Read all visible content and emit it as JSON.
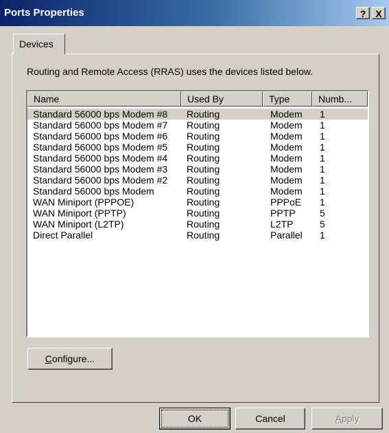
{
  "window": {
    "title": "Ports Properties",
    "help_label": "?",
    "close_label": "X"
  },
  "tabs": [
    {
      "label": "Devices"
    }
  ],
  "description": "Routing and Remote Access (RRAS) uses the devices listed below.",
  "list": {
    "columns": [
      "Name",
      "Used By",
      "Type",
      "Numb..."
    ],
    "rows": [
      [
        "Standard 56000 bps Modem #8",
        "Routing",
        "Modem",
        "1"
      ],
      [
        "Standard 56000 bps Modem #7",
        "Routing",
        "Modem",
        "1"
      ],
      [
        "Standard 56000 bps Modem #6",
        "Routing",
        "Modem",
        "1"
      ],
      [
        "Standard 56000 bps Modem #5",
        "Routing",
        "Modem",
        "1"
      ],
      [
        "Standard 56000 bps Modem #4",
        "Routing",
        "Modem",
        "1"
      ],
      [
        "Standard 56000 bps Modem #3",
        "Routing",
        "Modem",
        "1"
      ],
      [
        "Standard 56000 bps Modem #2",
        "Routing",
        "Modem",
        "1"
      ],
      [
        "Standard 56000 bps Modem",
        "Routing",
        "Modem",
        "1"
      ],
      [
        "WAN Miniport (PPPOE)",
        "Routing",
        "PPPoE",
        "1"
      ],
      [
        "WAN Miniport (PPTP)",
        "Routing",
        "PPTP",
        "5"
      ],
      [
        "WAN Miniport (L2TP)",
        "Routing",
        "L2TP",
        "5"
      ],
      [
        "Direct Parallel",
        "Routing",
        "Parallel",
        "1"
      ]
    ]
  },
  "buttons": {
    "configure_first": "C",
    "configure_rest": "onfigure...",
    "ok": "OK",
    "cancel": "Cancel",
    "apply_first": "A",
    "apply_rest": "pply"
  }
}
